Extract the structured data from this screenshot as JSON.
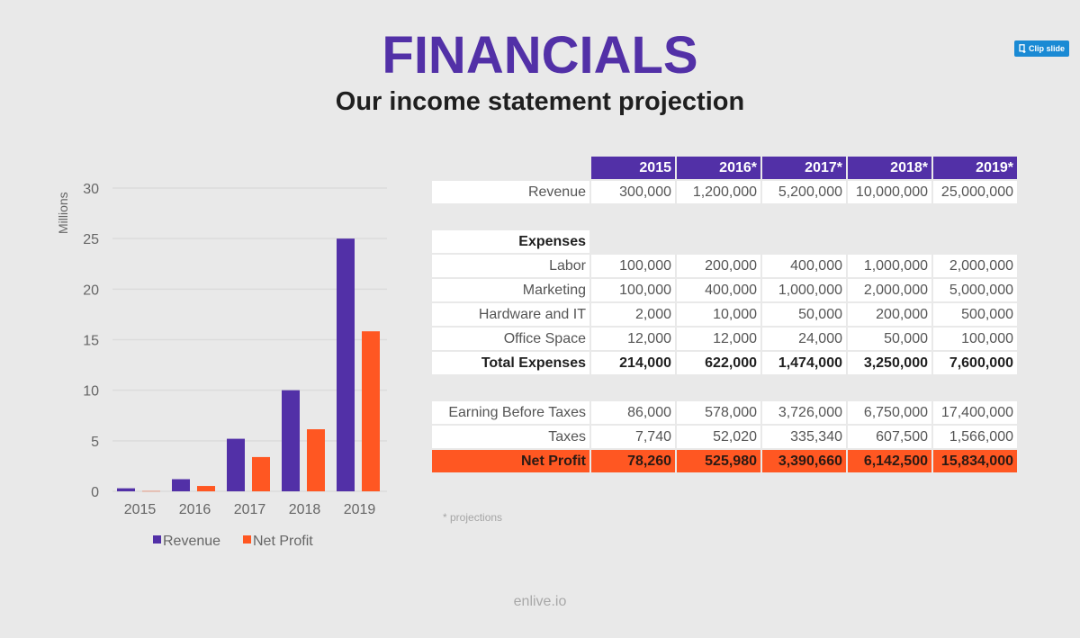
{
  "slide": {
    "title": "FINANCIALS",
    "subtitle": "Our income statement projection",
    "clip_button_label": "Clip slide",
    "footnote": "* projections",
    "brand": "enlive.io"
  },
  "colors": {
    "purple": "#5230a7",
    "orange": "#ff5722",
    "clip_blue": "#1a8ad4"
  },
  "table": {
    "headers": [
      "",
      "2015",
      "2016*",
      "2017*",
      "2018*",
      "2019*"
    ],
    "revenue": {
      "label": "Revenue",
      "values": [
        "300,000",
        "1,200,000",
        "5,200,000",
        "10,000,000",
        "25,000,000"
      ]
    },
    "expenses_header": "Expenses",
    "expenses": [
      {
        "label": "Labor",
        "values": [
          "100,000",
          "200,000",
          "400,000",
          "1,000,000",
          "2,000,000"
        ]
      },
      {
        "label": "Marketing",
        "values": [
          "100,000",
          "400,000",
          "1,000,000",
          "2,000,000",
          "5,000,000"
        ]
      },
      {
        "label": "Hardware and IT",
        "values": [
          "2,000",
          "10,000",
          "50,000",
          "200,000",
          "500,000"
        ]
      },
      {
        "label": "Office Space",
        "values": [
          "12,000",
          "12,000",
          "24,000",
          "50,000",
          "100,000"
        ]
      }
    ],
    "total_expenses": {
      "label": "Total Expenses",
      "values": [
        "214,000",
        "622,000",
        "1,474,000",
        "3,250,000",
        "7,600,000"
      ]
    },
    "ebt": {
      "label": "Earning Before Taxes",
      "values": [
        "86,000",
        "578,000",
        "3,726,000",
        "6,750,000",
        "17,400,000"
      ]
    },
    "taxes": {
      "label": "Taxes",
      "values": [
        "7,740",
        "52,020",
        "335,340",
        "607,500",
        "1,566,000"
      ]
    },
    "net_profit": {
      "label": "Net Profit",
      "values": [
        "78,260",
        "525,980",
        "3,390,660",
        "6,142,500",
        "15,834,000"
      ]
    }
  },
  "chart_data": {
    "type": "bar",
    "title": "",
    "xlabel": "",
    "ylabel": "Millions",
    "categories": [
      "2015",
      "2016",
      "2017",
      "2018",
      "2019"
    ],
    "series": [
      {
        "name": "Revenue",
        "color": "#5230a7",
        "values": [
          0.3,
          1.2,
          5.2,
          10.0,
          25.0
        ]
      },
      {
        "name": "Net Profit",
        "color": "#ff5722",
        "values": [
          0.08,
          0.53,
          3.39,
          6.14,
          15.83
        ]
      }
    ],
    "ylim": [
      0,
      30
    ],
    "yticks": [
      "0",
      "5",
      "10",
      "15",
      "20",
      "25",
      "30"
    ],
    "grid": true,
    "legend": "bottom"
  }
}
